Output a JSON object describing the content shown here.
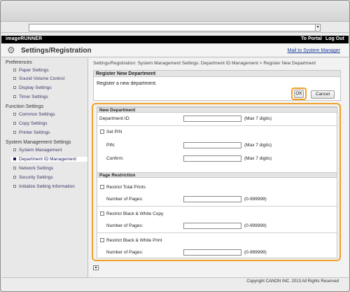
{
  "topbar": {
    "brand": "imageRUNNER",
    "to_portal": "To Portal",
    "log_out": "Log Out"
  },
  "header": {
    "title": "Settings/Registration",
    "mail_link": "Mail to System Manager",
    "icon": "gear-icon"
  },
  "sidebar": {
    "sections": [
      {
        "label": "Preferences",
        "items": [
          "Paper Settings",
          "Sound Volume Control",
          "Display Settings",
          "Timer Settings"
        ]
      },
      {
        "label": "Function Settings",
        "items": [
          "Common Settings",
          "Copy Settings",
          "Printer Settings"
        ]
      },
      {
        "label": "System Management Settings",
        "items": [
          "System Management",
          "Department ID Management",
          "Network Settings",
          "Security Settings",
          "Initialize Setting Information"
        ]
      }
    ],
    "active_item": "Department ID Management"
  },
  "breadcrumb": "Settings/Registration: System Management Settings: Department ID Management > Register New Department",
  "register_panel": {
    "title": "Register New Department",
    "intro": "Register a new department.",
    "ok": "OK",
    "cancel": "Cancel"
  },
  "new_department": {
    "title": "New Department",
    "dept_id_label": "Department ID:",
    "dept_id_value": "",
    "dept_id_hint": "(Max 7 digits)",
    "set_pin_label": "Set PIN",
    "set_pin_checked": false,
    "pin_label": "PIN:",
    "pin_value": "",
    "pin_hint": "(Max 7 digits)",
    "confirm_label": "Confirm:",
    "confirm_value": "",
    "confirm_hint": "(Max 7 digits)"
  },
  "page_restriction": {
    "title": "Page Restriction",
    "rows": [
      {
        "checkbox_label": "Restrict Total Prints",
        "pages_label": "Number of Pages:",
        "range": "(0-999999)"
      },
      {
        "checkbox_label": "Restrict Black & White Copy",
        "pages_label": "Number of Pages:",
        "range": "(0-999999)"
      },
      {
        "checkbox_label": "Restrict Black & White Print",
        "pages_label": "Number of Pages:",
        "range": "(0-999999)"
      }
    ]
  },
  "footer": {
    "copyright": "Copyright CANON INC. 2013 All Rights Reserved"
  },
  "colors": {
    "highlight": "#f1a028",
    "topbar": "#000000",
    "link": "#1a3a9a"
  }
}
